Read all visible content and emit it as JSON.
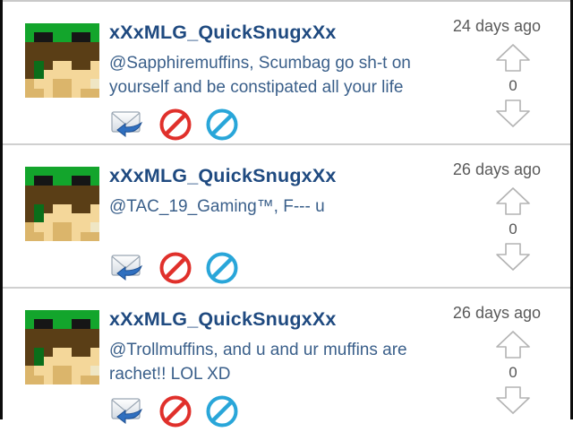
{
  "comments": [
    {
      "username": "xXxMLG_QuickSnugxXx",
      "time": "24 days ago",
      "text": "@Sapphiremuffins, Scumbag go sh-t on yourself and be constipated all your life",
      "score": "0"
    },
    {
      "username": "xXxMLG_QuickSnugxXx",
      "time": "26 days ago",
      "text": "@TAC_19_Gaming™, F--- u",
      "score": "0"
    },
    {
      "username": "xXxMLG_QuickSnugxXx",
      "time": "26 days ago",
      "text": "@Trollmuffins, and u and ur muffins are rachet!! LOL XD",
      "score": "0"
    }
  ],
  "icons": {
    "reply": "reply-mail-icon",
    "block": "block-icon",
    "report": "report-icon",
    "upvote": "upvote-arrow-icon",
    "downvote": "downvote-arrow-icon"
  },
  "colors": {
    "username": "#1f4a80",
    "text": "#3a5f8a",
    "time": "#5a5a5a",
    "block_red": "#e0302b",
    "report_blue": "#29a6d9"
  }
}
